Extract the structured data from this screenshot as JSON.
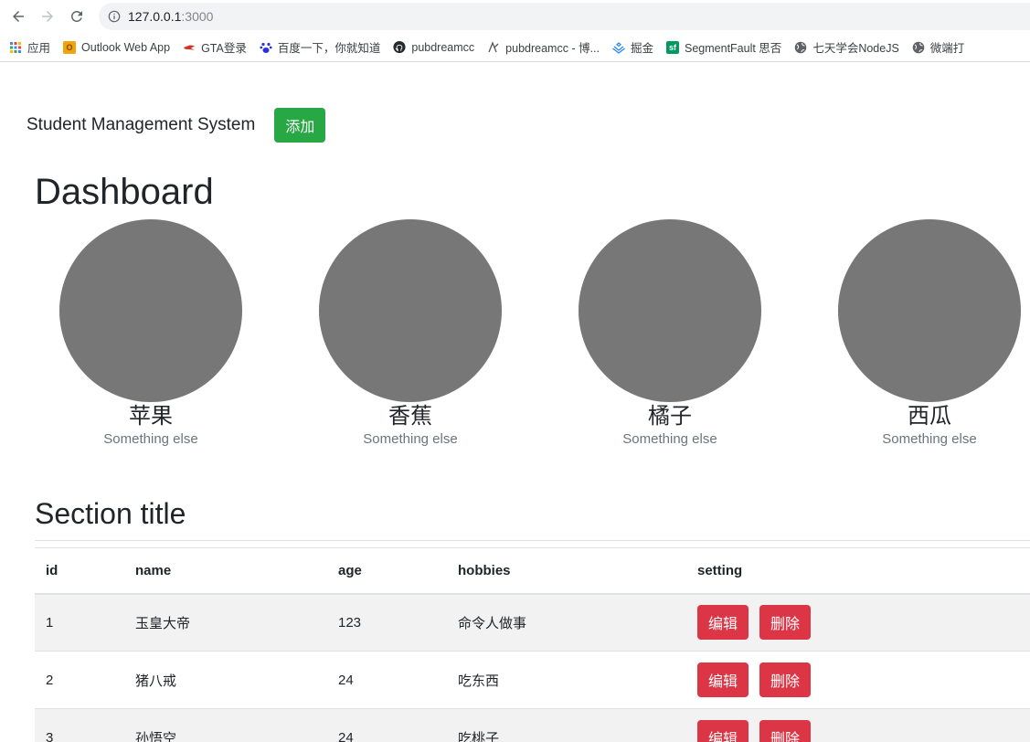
{
  "browser": {
    "url_host": "127.0.0.1",
    "url_port": ":3000"
  },
  "bookmarks": [
    {
      "label": "应用",
      "icon": "apps-grid-icon",
      "color": "#4285f4"
    },
    {
      "label": "Outlook Web App",
      "icon": "outlook-icon",
      "color": "#e8a317"
    },
    {
      "label": "GTA登录",
      "icon": "gta-icon",
      "color": "#d93025"
    },
    {
      "label": "百度一下，你就知道",
      "icon": "baidu-paw-icon",
      "color": "#2932e1"
    },
    {
      "label": "pubdreamcc",
      "icon": "github-icon",
      "color": "#24292e"
    },
    {
      "label": "pubdreamcc - 博...",
      "icon": "blog-icon",
      "color": "#555555"
    },
    {
      "label": "掘金",
      "icon": "juejin-icon",
      "color": "#1e80ff"
    },
    {
      "label": "SegmentFault 思否",
      "icon": "sf-icon",
      "color": "#009a61"
    },
    {
      "label": "七天学会NodeJS",
      "icon": "globe-icon",
      "color": "#5f6368"
    },
    {
      "label": "微端打",
      "icon": "globe-icon",
      "color": "#5f6368"
    }
  ],
  "navbar": {
    "brand": "Student Management System",
    "add_label": "添加",
    "add_color": "#28a745"
  },
  "dashboard": {
    "title": "Dashboard",
    "cards": [
      {
        "title": "苹果",
        "subtitle": "Something else"
      },
      {
        "title": "香蕉",
        "subtitle": "Something else"
      },
      {
        "title": "橘子",
        "subtitle": "Something else"
      },
      {
        "title": "西瓜",
        "subtitle": "Something else"
      }
    ]
  },
  "section": {
    "title": "Section title",
    "columns": [
      "id",
      "name",
      "age",
      "hobbies",
      "setting"
    ],
    "rows": [
      {
        "id": "1",
        "name": "玉皇大帝",
        "age": "123",
        "hobbies": "命令人做事"
      },
      {
        "id": "2",
        "name": "猪八戒",
        "age": "24",
        "hobbies": "吃东西"
      },
      {
        "id": "3",
        "name": "孙悟空",
        "age": "24",
        "hobbies": "吃桃子"
      }
    ],
    "edit_label": "编辑",
    "delete_label": "删除",
    "danger_color": "#dc3545"
  }
}
